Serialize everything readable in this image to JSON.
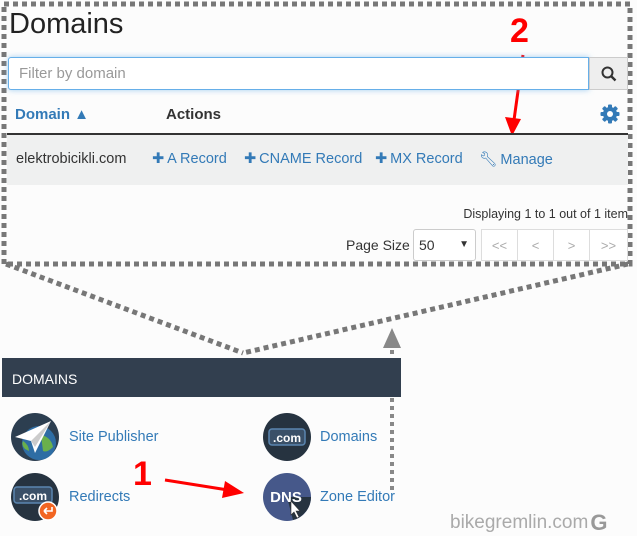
{
  "page": {
    "title": "Domains"
  },
  "filter": {
    "placeholder": "Filter by domain"
  },
  "table": {
    "columns": [
      "Domain ▲",
      "Actions"
    ],
    "rows": [
      {
        "domain": "elektrobicikli.com",
        "actions": [
          "A Record",
          "CNAME Record",
          "MX Record",
          "Manage"
        ]
      }
    ]
  },
  "pagination": {
    "displaying": "Displaying 1 to 1 out of 1 item",
    "page_size_label": "Page Size",
    "page_size": "50",
    "buttons": [
      "<<",
      "<",
      ">",
      ">>"
    ]
  },
  "section": {
    "header": "DOMAINS",
    "tiles": [
      {
        "label": "Site Publisher",
        "icon": "paper-plane-globe-icon"
      },
      {
        "label": "Domains",
        "icon": "dotcom-icon",
        "icon_text": ".com"
      },
      {
        "label": "Redirects",
        "icon": "dotcom-redirect-icon",
        "icon_text": ".com"
      },
      {
        "label": "Zone Editor",
        "icon": "dns-icon",
        "icon_text": "DNS"
      }
    ]
  },
  "annotations": {
    "step1": "1",
    "step2": "2"
  },
  "watermark": "bikegremlin.com",
  "colors": {
    "link": "#337ab7",
    "header_bar": "#323f4f",
    "annotation": "#ff0000"
  }
}
